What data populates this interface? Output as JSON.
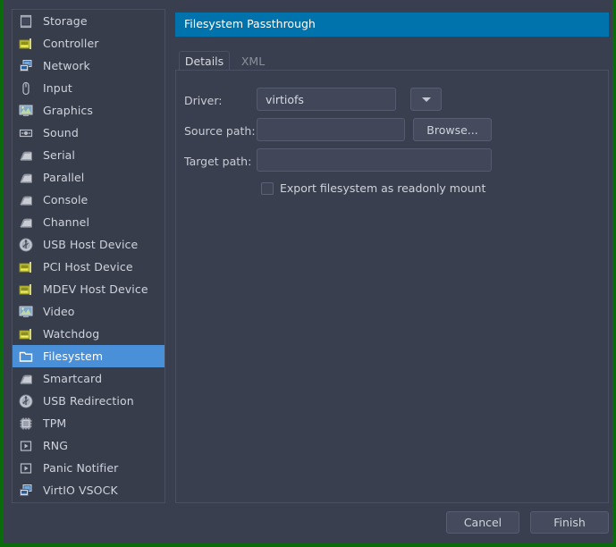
{
  "window": {
    "accent_color": "#0073ac",
    "selection_color": "#4a90d9",
    "background_color": "#3a3f4f",
    "border_color": "#0a6b0a"
  },
  "sidebar": {
    "items": [
      {
        "label": "Storage",
        "icon": "storage-icon",
        "selected": false
      },
      {
        "label": "Controller",
        "icon": "controller-icon",
        "selected": false
      },
      {
        "label": "Network",
        "icon": "network-icon",
        "selected": false
      },
      {
        "label": "Input",
        "icon": "input-mouse-icon",
        "selected": false
      },
      {
        "label": "Graphics",
        "icon": "graphics-icon",
        "selected": false
      },
      {
        "label": "Sound",
        "icon": "sound-icon",
        "selected": false
      },
      {
        "label": "Serial",
        "icon": "serial-icon",
        "selected": false
      },
      {
        "label": "Parallel",
        "icon": "parallel-icon",
        "selected": false
      },
      {
        "label": "Console",
        "icon": "console-icon",
        "selected": false
      },
      {
        "label": "Channel",
        "icon": "channel-icon",
        "selected": false
      },
      {
        "label": "USB Host Device",
        "icon": "usb-icon",
        "selected": false
      },
      {
        "label": "PCI Host Device",
        "icon": "pci-card-icon",
        "selected": false
      },
      {
        "label": "MDEV Host Device",
        "icon": "pci-card-icon",
        "selected": false
      },
      {
        "label": "Video",
        "icon": "video-icon",
        "selected": false
      },
      {
        "label": "Watchdog",
        "icon": "watchdog-icon",
        "selected": false
      },
      {
        "label": "Filesystem",
        "icon": "folder-icon",
        "selected": true
      },
      {
        "label": "Smartcard",
        "icon": "smartcard-icon",
        "selected": false
      },
      {
        "label": "USB Redirection",
        "icon": "usb-icon",
        "selected": false
      },
      {
        "label": "TPM",
        "icon": "chip-icon",
        "selected": false
      },
      {
        "label": "RNG",
        "icon": "media-play-icon",
        "selected": false
      },
      {
        "label": "Panic Notifier",
        "icon": "media-play-icon",
        "selected": false
      },
      {
        "label": "VirtIO VSOCK",
        "icon": "network-icon",
        "selected": false
      }
    ]
  },
  "main": {
    "header_title": "Filesystem Passthrough",
    "tabs": [
      {
        "label": "Details",
        "active": true
      },
      {
        "label": "XML",
        "active": false
      }
    ],
    "form": {
      "driver_label": "Driver:",
      "driver_value": "virtiofs",
      "driver_options": [
        "virtiofs"
      ],
      "source_path_label": "Source path:",
      "source_path_value": "",
      "source_path_placeholder": "",
      "browse_label": "Browse...",
      "target_path_label": "Target path:",
      "target_path_value": "",
      "target_path_placeholder": "",
      "readonly_checkbox_label": "Export filesystem as readonly mount",
      "readonly_checked": false
    }
  },
  "footer": {
    "cancel_label": "Cancel",
    "finish_label": "Finish"
  }
}
